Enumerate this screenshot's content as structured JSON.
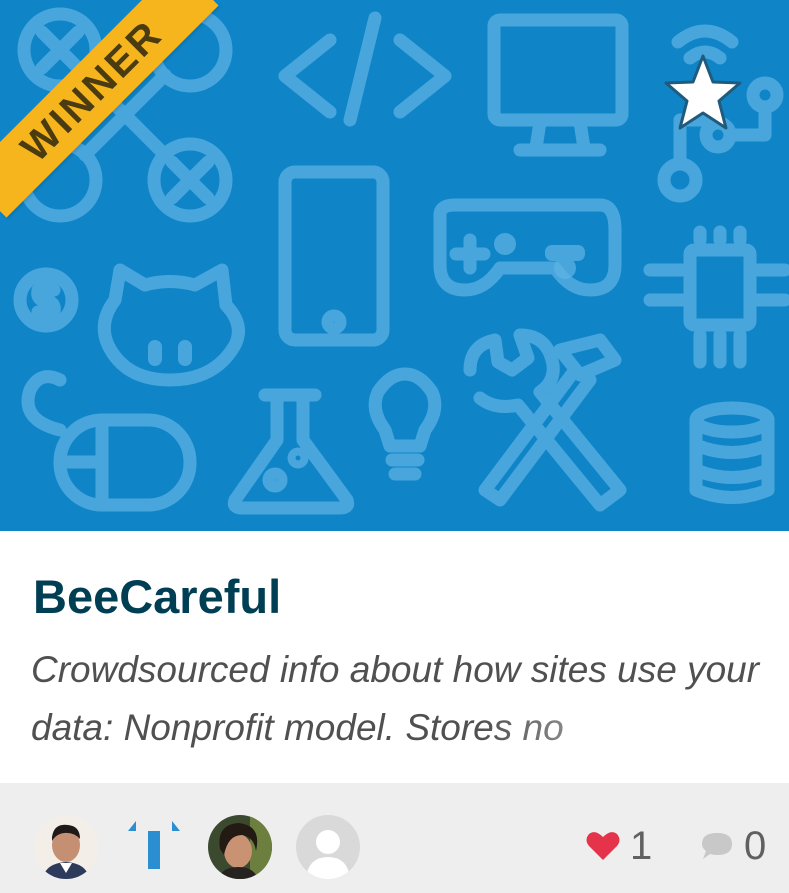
{
  "badge": {
    "label": "WINNER"
  },
  "project": {
    "title": "BeeCareful",
    "description": "Crowdsourced info about how sites use your data: Nonprofit model. Stores no"
  },
  "footer": {
    "likes": "1",
    "comments": "0"
  },
  "colors": {
    "header_bg": "#0f85c8",
    "ribbon": "#f7b51d",
    "title": "#003e54",
    "heart": "#e5334b",
    "footer_bg": "#eeeeee"
  },
  "icons": [
    "star-icon",
    "heart-icon",
    "comment-icon"
  ]
}
